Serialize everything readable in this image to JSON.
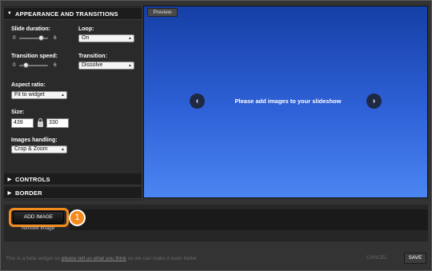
{
  "sections": {
    "appearance": "APPEARANCE AND TRANSITIONS",
    "controls": "CONTROLS",
    "border": "BORDER"
  },
  "slide_duration": {
    "label": "Slide duration:",
    "min": "0",
    "max": "6",
    "value": 5
  },
  "loop": {
    "label": "Loop:",
    "value": "On"
  },
  "transition_speed": {
    "label": "Transition speed:",
    "min": "0",
    "max": "6",
    "value": 1
  },
  "transition": {
    "label": "Transition:",
    "value": "Dissolve"
  },
  "aspect_ratio": {
    "label": "Aspect ratio:",
    "value": "Fit to widget"
  },
  "size": {
    "label": "Size:",
    "width": "439",
    "height": "330"
  },
  "images_handling": {
    "label": "Images handling:",
    "value": "Crop & Zoom"
  },
  "preview": {
    "tab_label": "Preview",
    "message": "Please add images to your slideshow"
  },
  "images": {
    "add_button": "ADD IMAGE",
    "remove_link": "remove image",
    "step_badge": "1"
  },
  "footer": {
    "beta_prefix": "This is a beta widget so",
    "beta_link": "please tell us what you think",
    "beta_suffix": "so we can make it even better",
    "cancel": "CANCEL",
    "save": "SAVE"
  },
  "colors": {
    "highlight": "#f28a1e",
    "preview_top": "#153fa6",
    "preview_bottom": "#4b86f2"
  }
}
